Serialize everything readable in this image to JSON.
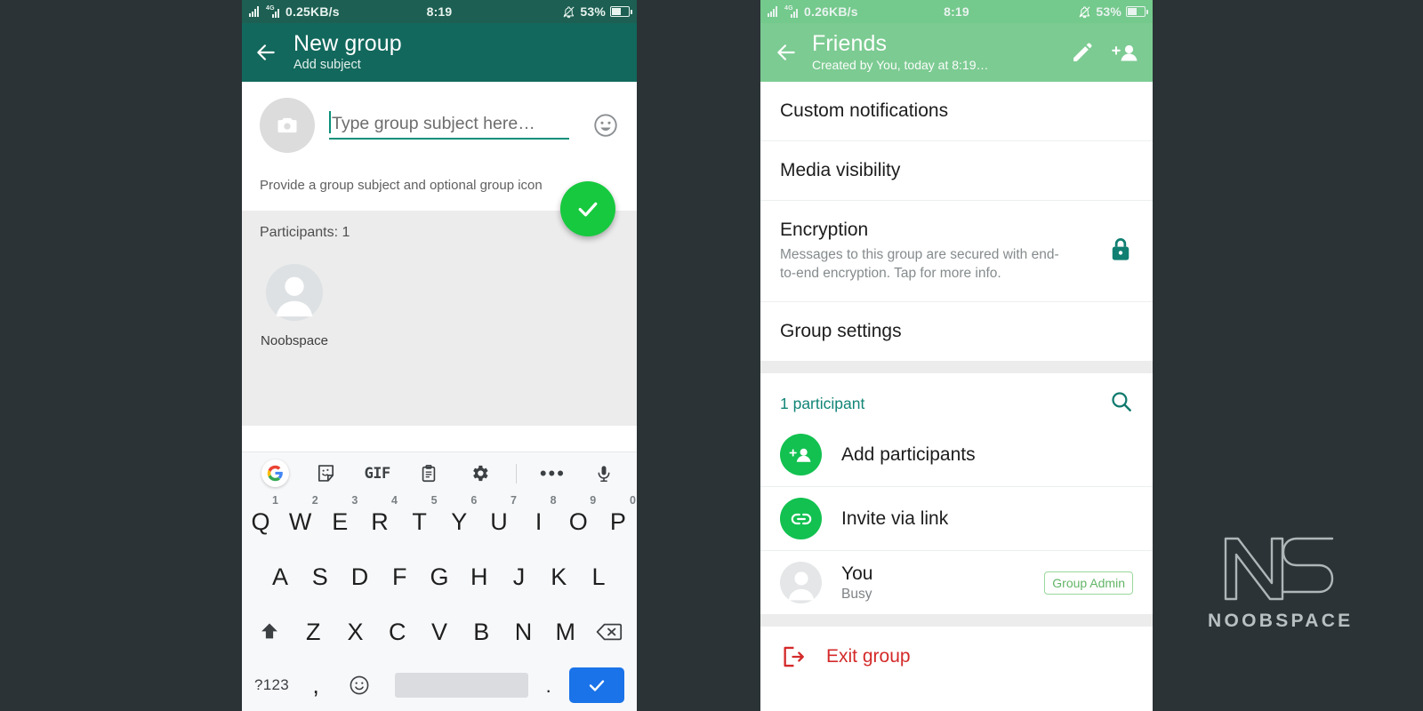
{
  "left_phone": {
    "status_bar": {
      "network_speed": "0.25KB/s",
      "time": "8:19",
      "battery": "53%",
      "icons": [
        "signal-bars-icon",
        "signal-4g-icon",
        "mute-bell-icon",
        "battery-icon"
      ]
    },
    "app_bar": {
      "title": "New group",
      "subtitle": "Add subject",
      "back_icon": "arrow-left-icon"
    },
    "subject_form": {
      "camera_icon": "camera-icon",
      "input_placeholder": "Type group subject here…",
      "input_value": "",
      "emoji_icon": "emoji-smiley-icon",
      "hint": "Provide a group subject and optional group icon"
    },
    "fab": {
      "icon": "check-icon",
      "color": "#17c93e"
    },
    "participants": {
      "count_label": "Participants: 1",
      "people": [
        {
          "name": "Noobspace",
          "avatar_icon": "person-avatar-icon"
        }
      ]
    },
    "keyboard": {
      "toolbar": [
        "google-g-icon",
        "sticker-icon",
        "GIF",
        "clipboard-icon",
        "gear-icon",
        "more-dots-icon",
        "microphone-icon"
      ],
      "row1": [
        {
          "key": "Q",
          "num": "1"
        },
        {
          "key": "W",
          "num": "2"
        },
        {
          "key": "E",
          "num": "3"
        },
        {
          "key": "R",
          "num": "4"
        },
        {
          "key": "T",
          "num": "5"
        },
        {
          "key": "Y",
          "num": "6"
        },
        {
          "key": "U",
          "num": "7"
        },
        {
          "key": "I",
          "num": "8"
        },
        {
          "key": "O",
          "num": "9"
        },
        {
          "key": "P",
          "num": "0"
        }
      ],
      "row2": [
        "A",
        "S",
        "D",
        "F",
        "G",
        "H",
        "J",
        "K",
        "L"
      ],
      "row3_shift_icon": "shift-arrow-icon",
      "row3": [
        "Z",
        "X",
        "C",
        "V",
        "B",
        "N",
        "M"
      ],
      "row3_backspace_icon": "backspace-icon",
      "row4": {
        "symbols": "?123",
        "comma": ",",
        "emoji_icon": "emoji-smiley-icon",
        "space": "",
        "period": ".",
        "enter_icon": "check-icon"
      }
    }
  },
  "right_phone": {
    "status_bar": {
      "network_speed": "0.26KB/s",
      "time": "8:19",
      "battery": "53%",
      "icons": [
        "signal-bars-icon",
        "signal-4g-icon",
        "mute-bell-icon",
        "battery-icon"
      ]
    },
    "app_bar": {
      "title": "Friends",
      "subtitle": "Created by You, today at 8:19…",
      "back_icon": "arrow-left-icon",
      "edit_icon": "pencil-icon",
      "add_person_icon": "add-person-icon"
    },
    "settings_items": [
      {
        "title": "Custom notifications",
        "subtitle": "",
        "right_icon": ""
      },
      {
        "title": "Media visibility",
        "subtitle": "",
        "right_icon": ""
      },
      {
        "title": "Encryption",
        "subtitle": "Messages to this group are secured with end-to-end encryption. Tap for more info.",
        "right_icon": "lock-icon"
      },
      {
        "title": "Group settings",
        "subtitle": "",
        "right_icon": ""
      }
    ],
    "participants": {
      "header_label": "1 participant",
      "search_icon": "search-icon",
      "actions": [
        {
          "label": "Add participants",
          "icon": "add-person-icon"
        },
        {
          "label": "Invite via link",
          "icon": "link-icon"
        }
      ],
      "members": [
        {
          "name": "You",
          "status": "Busy",
          "badge": "Group Admin",
          "avatar_icon": "person-avatar-icon"
        }
      ]
    },
    "exit": {
      "label": "Exit group",
      "icon": "exit-arrow-icon",
      "color": "#d42a2a"
    }
  },
  "watermark": {
    "logo_icon": "ns-monogram-icon",
    "word": "NOOBSPACE"
  },
  "theme": {
    "header_dark_teal": "#12685c",
    "header_light_green": "#7ccb92",
    "accent_green": "#12c150",
    "backdrop": "#2b3336"
  }
}
